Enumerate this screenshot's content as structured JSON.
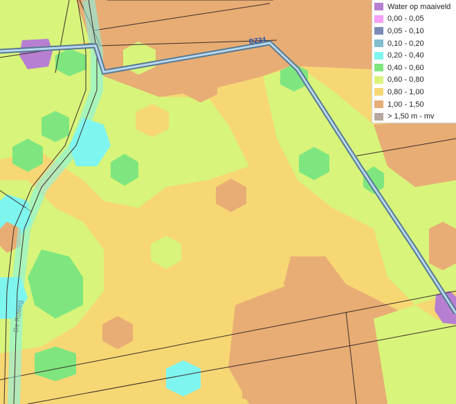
{
  "legend": {
    "items": [
      {
        "label": "Water op maaiveld",
        "color": "#b77fd1"
      },
      {
        "label": "0,00 - 0,05",
        "color": "#f59ef5"
      },
      {
        "label": "0,05 - 0,10",
        "color": "#7b8bb8"
      },
      {
        "label": "0,10 - 0,20",
        "color": "#7fbccf"
      },
      {
        "label": "0,20 - 0,40",
        "color": "#7ff5ef"
      },
      {
        "label": "0,40 - 0,60",
        "color": "#7fe67f"
      },
      {
        "label": "0,60 - 0,80",
        "color": "#d8f47a"
      },
      {
        "label": "0,80 - 1,00",
        "color": "#f6d774"
      },
      {
        "label": "1,00 - 1,50",
        "color": "#e8ad74"
      },
      {
        "label": "> 1,50 m - mv",
        "color": "#b9a8a0"
      }
    ]
  },
  "map": {
    "road_label_top": "BZ34",
    "road_label_left": "De Ruweg"
  }
}
